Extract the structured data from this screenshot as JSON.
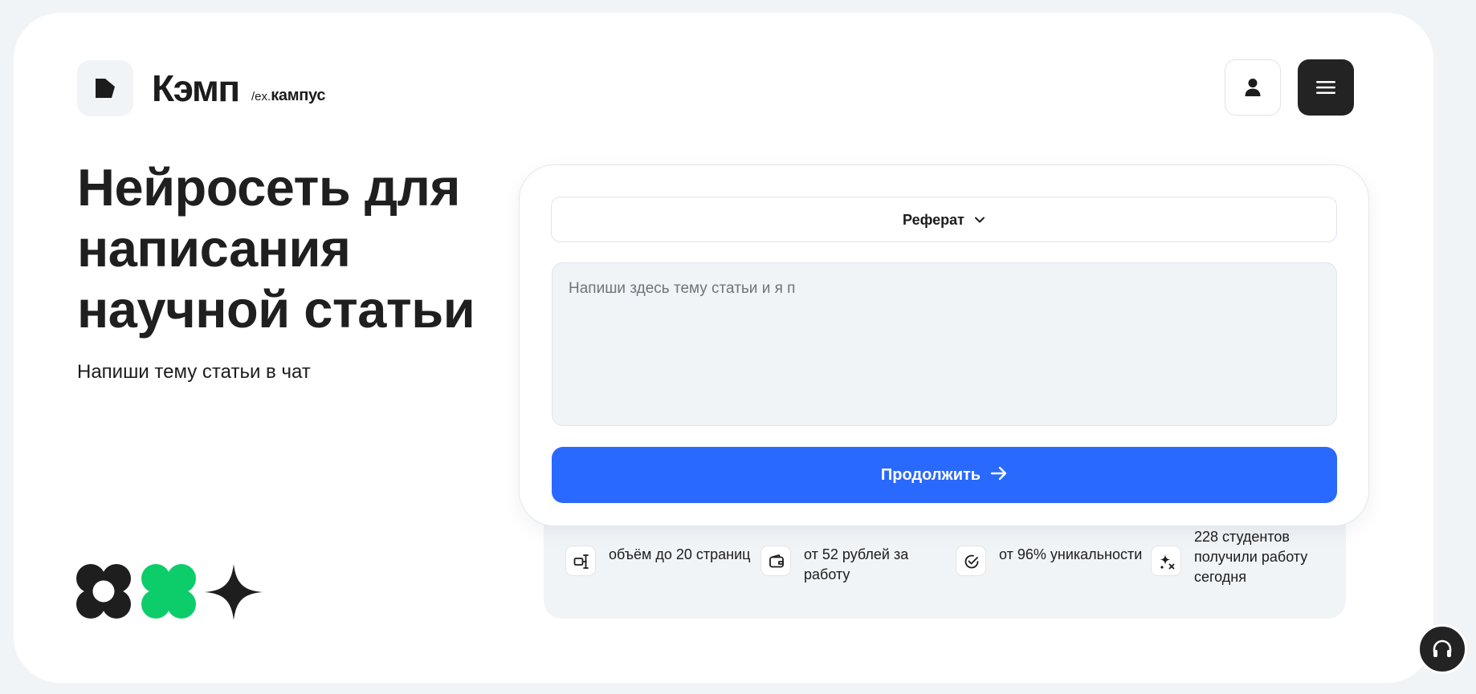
{
  "brand": {
    "name": "Кэмп",
    "sub_prefix": "/ex.",
    "sub_name": "кампус"
  },
  "hero": {
    "title": "Нейросеть для написания научной статьи",
    "subtitle": "Напиши тему статьи в чат"
  },
  "form": {
    "type_selected": "Реферат",
    "topic_placeholder": "Напиши здесь тему статьи и я п",
    "continue_label": "Продолжить"
  },
  "stats": [
    {
      "text": "объём до 20 страниц",
      "icon": "pages-volume-icon"
    },
    {
      "text": "от 52 рублей за работу",
      "icon": "wallet-icon"
    },
    {
      "text": "от 96% уникальности",
      "icon": "check-circle-icon"
    },
    {
      "text": "228 студентов получили работу сегодня",
      "icon": "sparkles-icon"
    }
  ],
  "colors": {
    "accent": "#2a69fd",
    "dark": "#232323",
    "green": "#0ccd6a",
    "panel": "#f1f4f7"
  }
}
